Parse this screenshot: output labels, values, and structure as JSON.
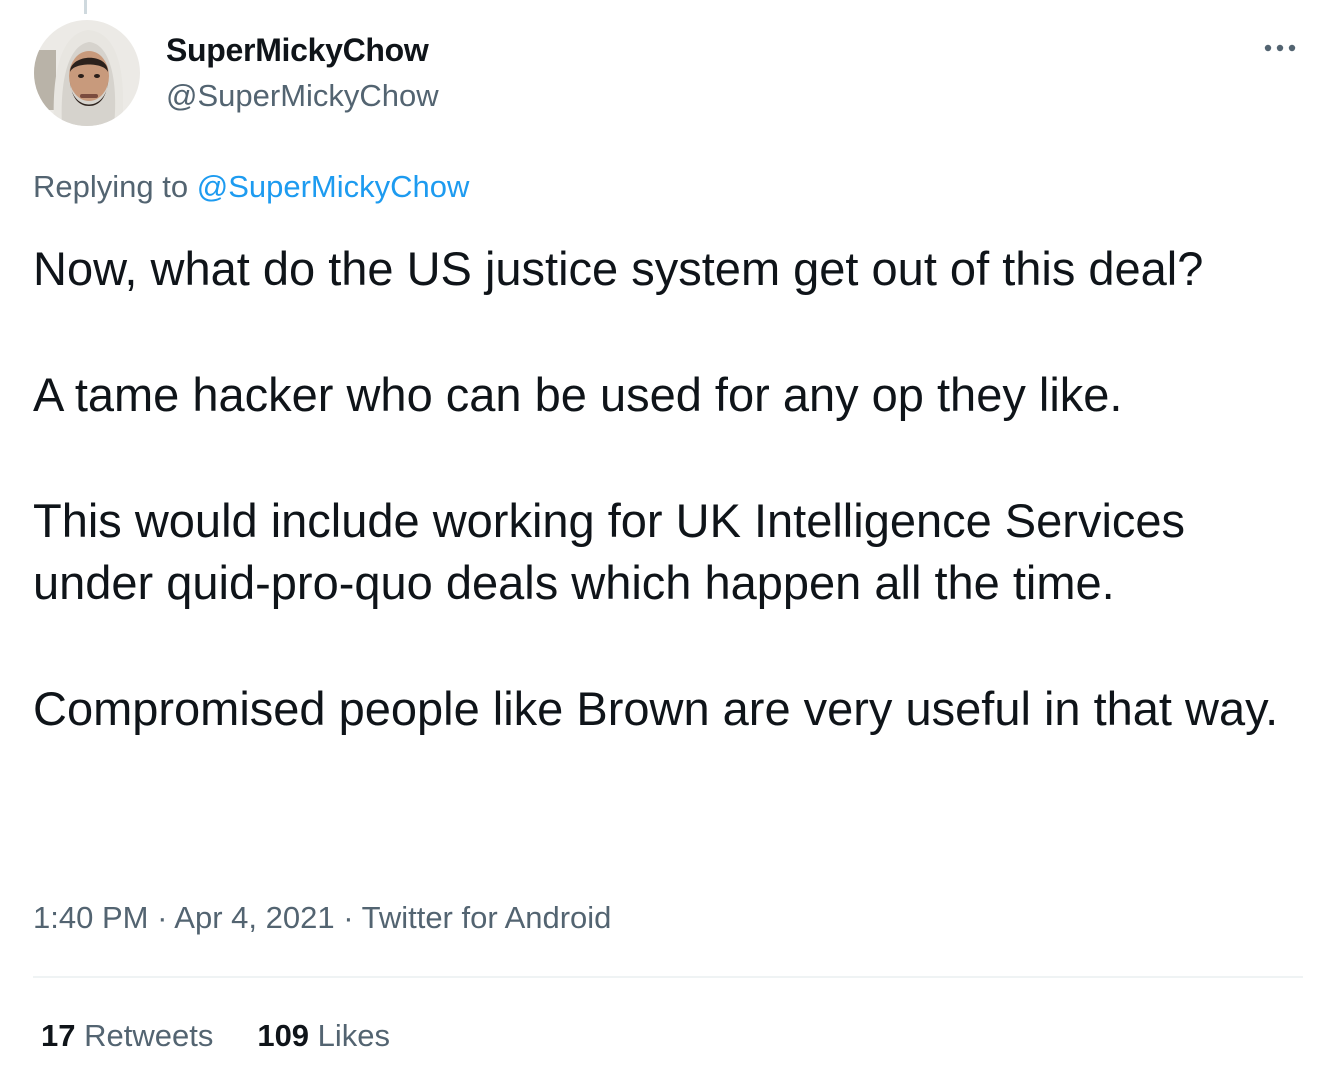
{
  "author": {
    "display_name": "SuperMickyChow",
    "handle": "@SuperMickyChow"
  },
  "reply": {
    "prefix": "Replying to ",
    "mention": "@SuperMickyChow"
  },
  "tweet": {
    "paragraphs": [
      "Now, what do the US justice system get out of this deal?",
      "A tame hacker who can be used for any op they like.",
      "This would include working for UK Intelligence Services under quid-pro-quo deals which happen all the time.",
      "Compromised people like Brown are very useful in that way."
    ]
  },
  "meta": {
    "time": "1:40 PM",
    "separator": " · ",
    "date": "Apr 4, 2021",
    "source": "Twitter for Android"
  },
  "stats": {
    "retweets_count": "17",
    "retweets_label": " Retweets",
    "likes_count": "109",
    "likes_label": " Likes"
  },
  "icons": {
    "more": "more-horizontal-icon"
  },
  "colors": {
    "text": "#0f1419",
    "secondary": "#536471",
    "accent": "#1d9bf0",
    "divider": "#eff3f4"
  }
}
